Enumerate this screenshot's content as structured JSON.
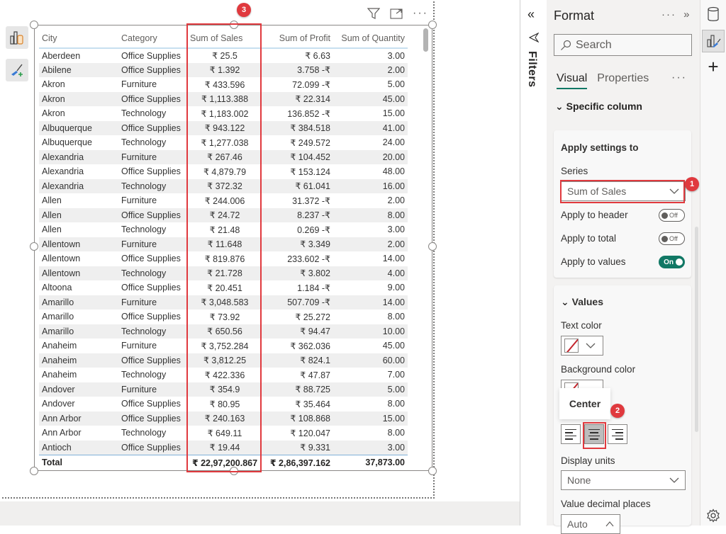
{
  "visual": {
    "header_icons": [
      "filter-icon",
      "focus-mode-icon",
      "more-options-icon"
    ],
    "columns": [
      {
        "key": "city",
        "label": "City"
      },
      {
        "key": "category",
        "label": "Category"
      },
      {
        "key": "sales",
        "label": "Sum of Sales"
      },
      {
        "key": "profit",
        "label": "Sum of Profit"
      },
      {
        "key": "quantity",
        "label": "Sum of Quantity"
      }
    ],
    "rows": [
      [
        "Aberdeen",
        "Office Supplies",
        "₹ 25.5",
        "₹ 6.63",
        "3.00"
      ],
      [
        "Abilene",
        "Office Supplies",
        "₹ 1.392",
        "3.758 -₹",
        "2.00"
      ],
      [
        "Akron",
        "Furniture",
        "₹ 433.596",
        "72.099 -₹",
        "5.00"
      ],
      [
        "Akron",
        "Office Supplies",
        "₹ 1,113.388",
        "₹ 22.314",
        "45.00"
      ],
      [
        "Akron",
        "Technology",
        "₹ 1,183.002",
        "136.852 -₹",
        "15.00"
      ],
      [
        "Albuquerque",
        "Office Supplies",
        "₹ 943.122",
        "₹ 384.518",
        "41.00"
      ],
      [
        "Albuquerque",
        "Technology",
        "₹ 1,277.038",
        "₹ 249.572",
        "24.00"
      ],
      [
        "Alexandria",
        "Furniture",
        "₹ 267.46",
        "₹ 104.452",
        "20.00"
      ],
      [
        "Alexandria",
        "Office Supplies",
        "₹ 4,879.79",
        "₹ 153.124",
        "48.00"
      ],
      [
        "Alexandria",
        "Technology",
        "₹ 372.32",
        "₹ 61.041",
        "16.00"
      ],
      [
        "Allen",
        "Furniture",
        "₹ 244.006",
        "31.372 -₹",
        "2.00"
      ],
      [
        "Allen",
        "Office Supplies",
        "₹ 24.72",
        "8.237 -₹",
        "8.00"
      ],
      [
        "Allen",
        "Technology",
        "₹ 21.48",
        "0.269 -₹",
        "3.00"
      ],
      [
        "Allentown",
        "Furniture",
        "₹ 11.648",
        "₹ 3.349",
        "2.00"
      ],
      [
        "Allentown",
        "Office Supplies",
        "₹ 819.876",
        "233.602 -₹",
        "14.00"
      ],
      [
        "Allentown",
        "Technology",
        "₹ 21.728",
        "₹ 3.802",
        "4.00"
      ],
      [
        "Altoona",
        "Office Supplies",
        "₹ 20.451",
        "1.184 -₹",
        "9.00"
      ],
      [
        "Amarillo",
        "Furniture",
        "₹ 3,048.583",
        "507.709 -₹",
        "14.00"
      ],
      [
        "Amarillo",
        "Office Supplies",
        "₹ 73.92",
        "₹ 25.272",
        "8.00"
      ],
      [
        "Amarillo",
        "Technology",
        "₹ 650.56",
        "₹ 94.47",
        "10.00"
      ],
      [
        "Anaheim",
        "Furniture",
        "₹ 3,752.284",
        "₹ 362.036",
        "45.00"
      ],
      [
        "Anaheim",
        "Office Supplies",
        "₹ 3,812.25",
        "₹ 824.1",
        "60.00"
      ],
      [
        "Anaheim",
        "Technology",
        "₹ 422.336",
        "₹ 47.87",
        "7.00"
      ],
      [
        "Andover",
        "Furniture",
        "₹ 354.9",
        "₹ 88.725",
        "5.00"
      ],
      [
        "Andover",
        "Office Supplies",
        "₹ 80.95",
        "₹ 35.464",
        "8.00"
      ],
      [
        "Ann Arbor",
        "Office Supplies",
        "₹ 240.163",
        "₹ 108.868",
        "15.00"
      ],
      [
        "Ann Arbor",
        "Technology",
        "₹ 649.11",
        "₹ 120.047",
        "8.00"
      ],
      [
        "Antioch",
        "Office Supplies",
        "₹ 19.44",
        "₹ 9.331",
        "3.00"
      ]
    ],
    "total": {
      "label": "Total",
      "category": "",
      "sales": "₹ 22,97,200.867",
      "profit": "₹ 2,86,397.162",
      "quantity": "37,873.00"
    }
  },
  "annotations": {
    "badge_1": "1",
    "badge_2": "2",
    "badge_3": "3",
    "color": "#e0393e"
  },
  "filters": {
    "collapse_icon": "«",
    "label": "Filters"
  },
  "format_pane": {
    "title": "Format",
    "more": "···",
    "expand_icon": "»",
    "search_placeholder": "Search",
    "tabs": [
      {
        "label": "Visual",
        "active": true
      },
      {
        "label": "Properties",
        "active": false
      }
    ],
    "tabs_more": "···",
    "section": "Specific column",
    "apply_settings": {
      "heading": "Apply settings to",
      "series_label": "Series",
      "series_value": "Sum of Sales",
      "apply_header": {
        "label": "Apply to header",
        "state": "Off"
      },
      "apply_total": {
        "label": "Apply to total",
        "state": "Off"
      },
      "apply_values": {
        "label": "Apply to values",
        "state": "On"
      }
    },
    "values": {
      "heading": "Values",
      "text_color_label": "Text color",
      "background_color_label": "Background color",
      "alignment_tooltip": "Center",
      "alignment_selected": "center",
      "display_units_label": "Display units",
      "display_units_value": "None",
      "decimal_places_label": "Value decimal places",
      "decimal_places_value": "Auto"
    },
    "accent_color": "#117865"
  }
}
